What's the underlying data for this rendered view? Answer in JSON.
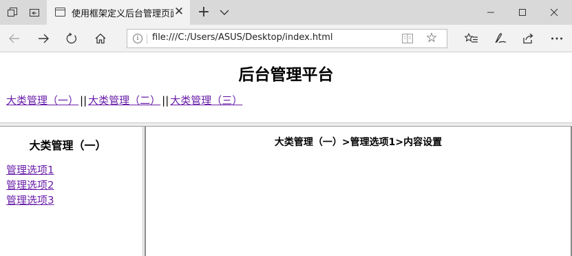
{
  "browser": {
    "tab": {
      "title": "使用框架定义后台管理页面"
    },
    "address": {
      "url": "file:///C:/Users/ASUS/Desktop/index.html"
    },
    "icons": {
      "tab_actions": "tab-actions-icon",
      "set_aside": "set-aside-tabs-icon",
      "page": "page-icon",
      "close": "close-icon",
      "new_tab": "plus-icon",
      "tab_list": "chevron-down-icon",
      "minimize": "minimize-icon",
      "maximize": "maximize-icon",
      "window_close": "window-close-icon",
      "back": "back-arrow-icon",
      "forward": "forward-arrow-icon",
      "refresh": "refresh-icon",
      "home": "home-icon",
      "info": "info-icon",
      "reading_view": "book-icon",
      "favorite": "star-icon",
      "favorites_list": "favorites-icon",
      "notes": "pen-icon",
      "share": "share-icon",
      "more": "more-icon"
    }
  },
  "page": {
    "title": "后台管理平台",
    "categories": [
      {
        "label": "大类管理（一）"
      },
      {
        "label": "大类管理（二）"
      },
      {
        "label": "大类管理（三）"
      }
    ],
    "separator": "||",
    "left": {
      "title": "大类管理（一）",
      "items": [
        {
          "label": "管理选项1"
        },
        {
          "label": "管理选项2"
        },
        {
          "label": "管理选项3"
        }
      ]
    },
    "main": {
      "breadcrumb": "大类管理（一）>管理选项1>内容设置"
    }
  },
  "colors": {
    "tabbar_bg": "#d9d9d9",
    "navbar_bg": "#f2f2f2",
    "visited_link": "#681da8",
    "frame_border": "#8a8a8a"
  }
}
